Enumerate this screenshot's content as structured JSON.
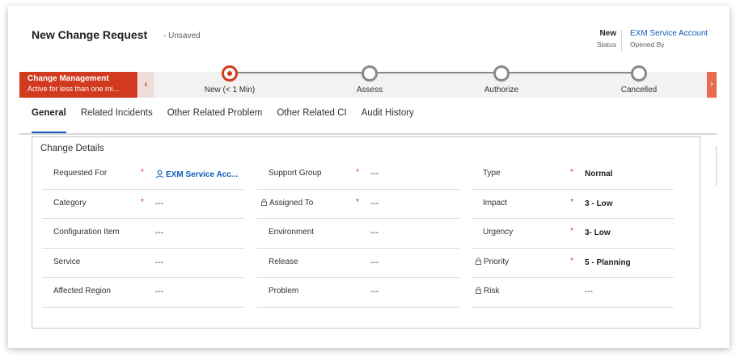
{
  "header": {
    "title": "New Change Request",
    "unsaved": "- Unsaved",
    "status_value": "New",
    "status_label": "Status",
    "opened_by_value": "EXM Service Account",
    "opened_by_label": "Opened By"
  },
  "process": {
    "active_stage_name": "Change Management",
    "active_stage_duration": "Active for less than one mi...",
    "stages": [
      {
        "label": "New  (< 1 Min)"
      },
      {
        "label": "Assess"
      },
      {
        "label": "Authorize"
      },
      {
        "label": "Cancelled"
      }
    ]
  },
  "tabs": [
    {
      "label": "General"
    },
    {
      "label": "Related Incidents"
    },
    {
      "label": "Other Related Problem"
    },
    {
      "label": "Other Related CI"
    },
    {
      "label": "Audit History"
    }
  ],
  "section": {
    "title": "Change Details",
    "col1": [
      {
        "label": "Requested For",
        "required": "*",
        "value": "EXM Service Acc..."
      },
      {
        "label": "Category",
        "required": "*",
        "value": "---"
      },
      {
        "label": "Configuration Item",
        "required": "",
        "value": "---"
      },
      {
        "label": "Service",
        "required": "",
        "value": "---"
      },
      {
        "label": "Affected Region",
        "required": "",
        "value": "---"
      }
    ],
    "col2": [
      {
        "label": "Support Group",
        "required": "*",
        "value": "---"
      },
      {
        "label": "Assigned To",
        "required": "*",
        "value": "---"
      },
      {
        "label": "Environment",
        "required": "",
        "value": "---"
      },
      {
        "label": "Release",
        "required": "",
        "value": "---"
      },
      {
        "label": "Problem",
        "required": "",
        "value": "---"
      }
    ],
    "col3": [
      {
        "label": "Type",
        "required": "*",
        "value": "Normal"
      },
      {
        "label": "Impact",
        "required": "*",
        "value": "3 - Low"
      },
      {
        "label": "Urgency",
        "required": "*",
        "value": "3- Low"
      },
      {
        "label": "Priority",
        "required": "*",
        "value": "5 - Planning"
      },
      {
        "label": "Risk",
        "required": "",
        "value": "---"
      }
    ]
  },
  "colors": {
    "accent": "#d13a1e",
    "link": "#0f5bb8",
    "required": "#d13438"
  }
}
